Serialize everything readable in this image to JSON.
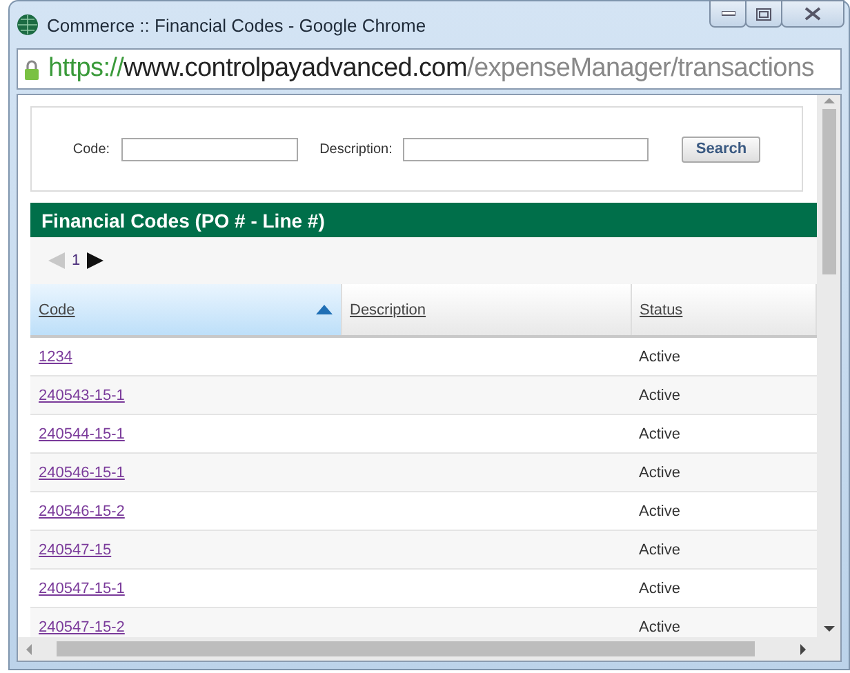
{
  "window": {
    "title": "Commerce :: Financial Codes - Google Chrome"
  },
  "address_bar": {
    "scheme": "https://",
    "host": "www.controlpayadvanced.com",
    "path": "/expenseManager/transactions",
    "secure": true
  },
  "search_form": {
    "fields": [
      {
        "label": "Code:"
      },
      {
        "label": "Description:"
      }
    ],
    "button": "Search"
  },
  "panel_title": "Financial Codes (PO # - Line #)",
  "pager": {
    "page": "1",
    "prev_disabled": true,
    "next_disabled": false
  },
  "table": {
    "columns": [
      {
        "label": "Code",
        "selected": true
      },
      {
        "label": "Description",
        "selected": false
      },
      {
        "label": "Status",
        "selected": false
      }
    ],
    "rows": [
      {
        "code": "1234",
        "status": "Active"
      },
      {
        "code": "240543-15-1",
        "status": "Active"
      },
      {
        "code": "240544-15-1",
        "status": "Active"
      },
      {
        "code": "240546-15-1",
        "status": "Active"
      },
      {
        "code": "240546-15-2",
        "status": "Active"
      },
      {
        "code": "240547-15",
        "status": "Active"
      },
      {
        "code": "240547-15-1",
        "status": "Active"
      },
      {
        "code": "240547-15-2",
        "status": "Active"
      }
    ]
  }
}
